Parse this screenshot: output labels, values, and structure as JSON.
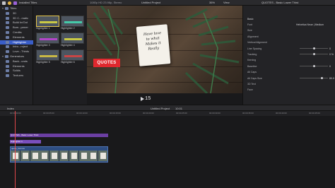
{
  "toolbar": {
    "library_label": "Installed Titles",
    "format_label": "1080p HD 23.98p, Stereo",
    "project_label": "Untitled Project",
    "zoom_label": "36%",
    "view_label": "View",
    "inspector_title": "QUOTES - Basic Lower Third"
  },
  "sidebar": {
    "items": [
      {
        "label": "Titles",
        "level": "top"
      },
      {
        "label": "3D",
        "level": "sub"
      },
      {
        "label": "3D C...matic",
        "level": "sub"
      },
      {
        "label": "Build In/Out",
        "level": "sub"
      },
      {
        "label": "Bum...pener",
        "level": "sub"
      },
      {
        "label": "Credits",
        "level": "sub"
      },
      {
        "label": "Elements",
        "level": "sub"
      },
      {
        "label": "Highlighter",
        "level": "sub",
        "selected": true
      },
      {
        "label": "Intro...roject",
        "level": "sub"
      },
      {
        "label": "Love...Thirds",
        "level": "sub"
      },
      {
        "label": "Generators",
        "level": "top"
      },
      {
        "label": "Back...unds",
        "level": "sub"
      },
      {
        "label": "Elements",
        "level": "sub"
      },
      {
        "label": "Solids",
        "level": "sub"
      },
      {
        "label": "Textures",
        "level": "sub"
      }
    ]
  },
  "browser": {
    "thumbs": [
      {
        "caption": "Highlighter 1",
        "bar_color": "#c9c945",
        "selected": true
      },
      {
        "caption": "Highlighter 2",
        "bar_color": "#45c9a8",
        "selected": false
      },
      {
        "caption": "Highlighter 3",
        "bar_color": "#b245c9",
        "selected": false
      },
      {
        "caption": "Highlighter 4",
        "bar_color": "#c9c945",
        "selected": false
      },
      {
        "caption": "Highlighter 5",
        "bar_color": "#c9b845",
        "selected": false
      },
      {
        "caption": "Highlighter 6",
        "bar_color": "#c94545",
        "selected": false
      }
    ]
  },
  "viewer": {
    "quote_badge": "QUOTES",
    "card_lines": [
      "Have love",
      "to what",
      "Makes it",
      "Really"
    ],
    "timecode": "15"
  },
  "inspector": {
    "tab_label": "Basic",
    "rows": [
      {
        "k": "Font",
        "v": "Helvetica Neue  |  Medium"
      },
      {
        "k": "Size",
        "v": ""
      },
      {
        "k": "Alignment",
        "v": ""
      },
      {
        "k": "Vertical Alignment",
        "v": ""
      },
      {
        "k": "Line Spacing",
        "v": "0"
      },
      {
        "k": "Tracking",
        "v": "0 %"
      },
      {
        "k": "Kerning",
        "v": ""
      },
      {
        "k": "Baseline",
        "v": "0"
      },
      {
        "k": "All Caps",
        "v": ""
      },
      {
        "k": "All Caps Size",
        "v": "80.0 %"
      },
      {
        "k": "3D Text",
        "v": ""
      },
      {
        "k": "Face",
        "v": ""
      }
    ]
  },
  "timeline": {
    "index_label": "Index",
    "project_label": "Untitled Project",
    "duration_label": "10:01",
    "ruler_ticks": [
      "00:00:00:00",
      "00:00:05:00",
      "00:00:10:00",
      "00:00:15:00",
      "00:00:20:00",
      "00:00:25:00",
      "00:00:30:00",
      "00:00:35:00",
      "00:00:40:00",
      "00:00:45:00"
    ],
    "clip_quotes": "QUOTES - Basic Lower Third",
    "clip_highlight": "Highlighter 1",
    "clip_video": "quote_hd.mov"
  }
}
